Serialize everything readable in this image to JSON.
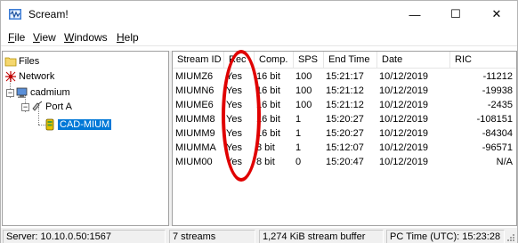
{
  "window": {
    "title": "Scream!",
    "controls": {
      "minimize": "—",
      "maximize": "☐",
      "close": "✕"
    }
  },
  "menu": [
    {
      "accel": "F",
      "rest": "ile"
    },
    {
      "accel": "V",
      "rest": "iew"
    },
    {
      "accel": "W",
      "rest": "indows"
    },
    {
      "accel": "H",
      "rest": "elp"
    }
  ],
  "tree": {
    "files": "Files",
    "network": "Network",
    "host": "cadmium",
    "port": "Port A",
    "device": "CAD-MIUM"
  },
  "list": {
    "columns": [
      "Stream ID",
      "Rec",
      "Comp.",
      "SPS",
      "End Time",
      "Date",
      "RIC"
    ],
    "rows": [
      [
        "MIUMZ6",
        "Yes",
        "16 bit",
        "100",
        "15:21:17",
        "10/12/2019",
        "-11212"
      ],
      [
        "MIUMN6",
        "Yes",
        "16 bit",
        "100",
        "15:21:12",
        "10/12/2019",
        "-19938"
      ],
      [
        "MIUME6",
        "Yes",
        "16 bit",
        "100",
        "15:21:12",
        "10/12/2019",
        "-2435"
      ],
      [
        "MIUMM8",
        "Yes",
        "16 bit",
        "1",
        "15:20:27",
        "10/12/2019",
        "-108151"
      ],
      [
        "MIUMM9",
        "Yes",
        "16 bit",
        "1",
        "15:20:27",
        "10/12/2019",
        "-84304"
      ],
      [
        "MIUMMA",
        "Yes",
        "8 bit",
        "1",
        "15:12:07",
        "10/12/2019",
        "-96571"
      ],
      [
        "MIUM00",
        "Yes",
        "8 bit",
        "0",
        "15:20:47",
        "10/12/2019",
        "N/A"
      ]
    ]
  },
  "status": {
    "server": "Server: 10.10.0.50:1567",
    "streams": "7 streams",
    "buffer": "1,274 KiB stream buffer",
    "pctime": "PC Time (UTC): 15:23:28"
  },
  "colors": {
    "selection": "#0078d7",
    "annotation": "#e00000"
  }
}
